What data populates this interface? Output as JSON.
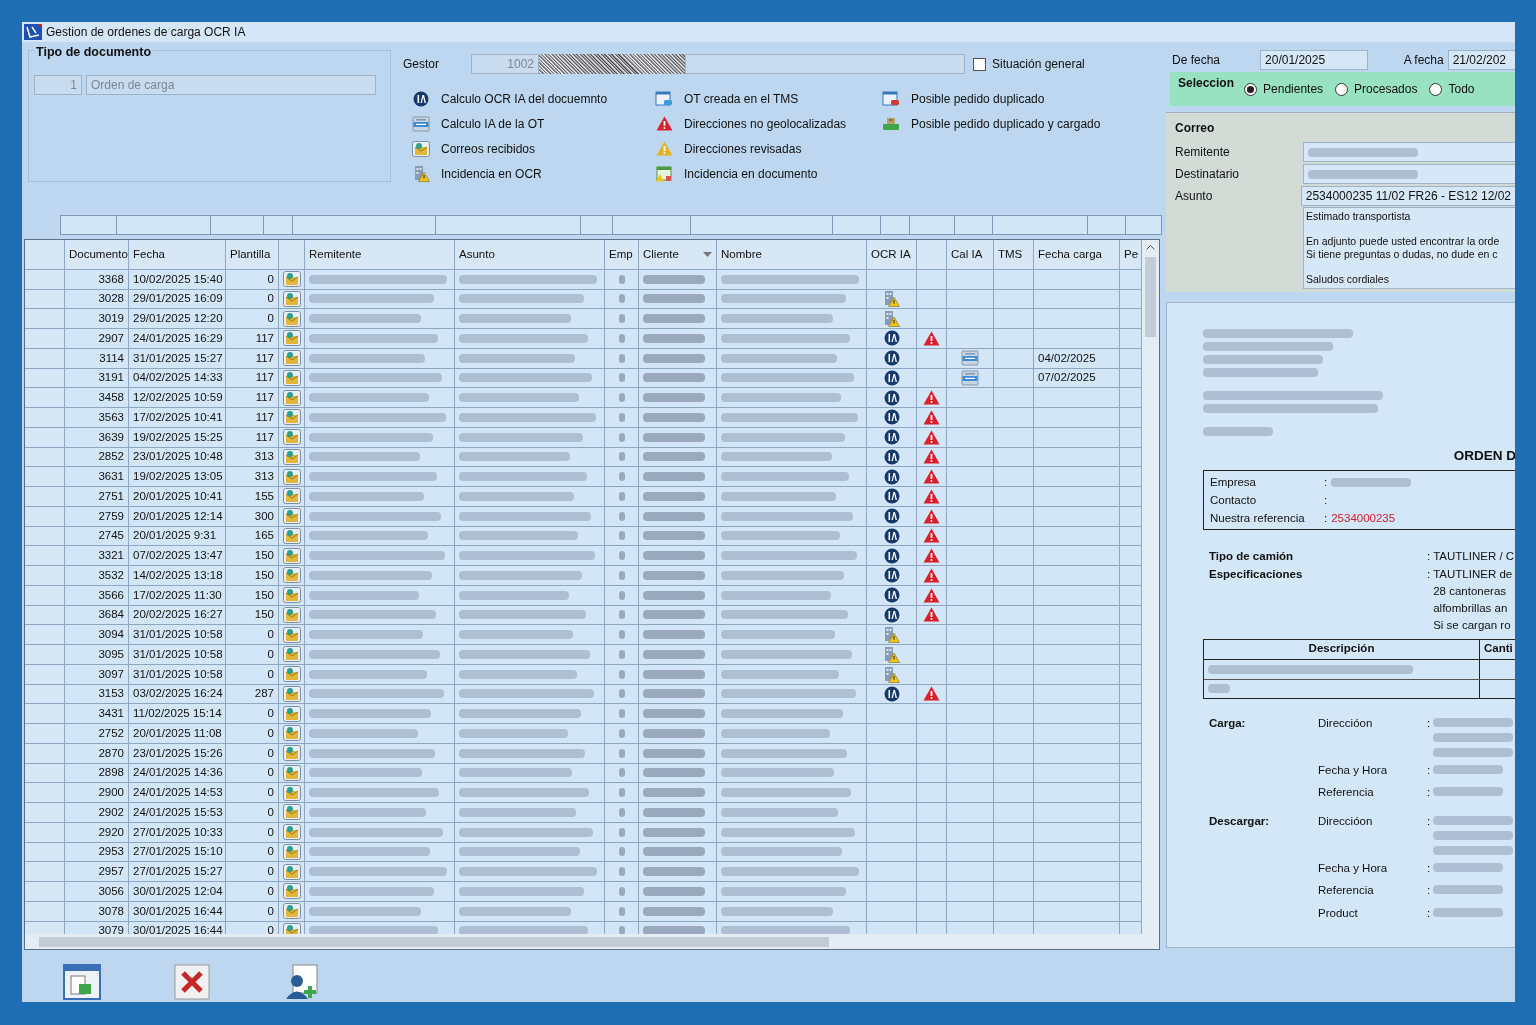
{
  "window": {
    "title": "Gestion de ordenes de carga OCR IA"
  },
  "document_type": {
    "title": "Tipo de documento",
    "code": "1",
    "name": "Orden de carga"
  },
  "gestor": {
    "label": "Gestor",
    "code": "1002"
  },
  "general_situation": {
    "label": "Situación general",
    "checked": false
  },
  "legend": [
    {
      "items": [
        {
          "kind": "ocr_ia",
          "label": "Calculo OCR IA del docuemnto"
        },
        {
          "kind": "cal_ia",
          "label": "Calculo IA de la OT"
        },
        {
          "kind": "mail",
          "label": "Correos recibidos"
        },
        {
          "kind": "ocr_incident",
          "label": "Incidencia en OCR"
        }
      ]
    },
    {
      "items": [
        {
          "kind": "tms",
          "label": "OT creada en el TMS"
        },
        {
          "kind": "red_alert",
          "label": "Direcciones no geolocalizadas"
        },
        {
          "kind": "yellow_alert",
          "label": "Direcciones revisadas"
        },
        {
          "kind": "doc_incident",
          "label": "Incidencia en documento"
        }
      ]
    },
    {
      "items": [
        {
          "kind": "duplicate",
          "label": "Posible pedido duplicado"
        },
        {
          "kind": "duplicate_loaded",
          "label": "Posible pedido duplicado y cargado"
        }
      ]
    }
  ],
  "date_range": {
    "from_label": "De fecha",
    "from": "20/01/2025",
    "to_label": "A fecha",
    "to": "21/02/202"
  },
  "selection": {
    "title": "Seleccion",
    "options": [
      {
        "label": "Pendientes",
        "selected": true
      },
      {
        "label": "Procesados",
        "selected": false
      },
      {
        "label": "Todo",
        "selected": false
      }
    ]
  },
  "mail": {
    "title": "Correo",
    "fields": [
      {
        "label": "Remitente",
        "kind": "blurred"
      },
      {
        "label": "Destinatario",
        "kind": "blurred"
      },
      {
        "label": "Asunto",
        "kind": "text",
        "value": "2534000235 11/02 FR26  - ES12 12/02"
      }
    ],
    "body": [
      "Estimado transportista",
      "En adjunto puede usted encontrar la orde\nSi tiene preguntas o dudas, no dude en c",
      "Saludos cordiales"
    ]
  },
  "table": {
    "columns": [
      "Documento",
      "Fecha",
      "Plantilla",
      "Remitente",
      "Asunto",
      "Emp",
      "Cliente",
      "Nombre",
      "OCR IA",
      "Cal IA",
      "TMS",
      "Fecha carga",
      "Pe"
    ],
    "rows": [
      {
        "documento": "3368",
        "fecha": "10/02/2025 15:40",
        "plantilla": "0",
        "kind": "none",
        "alert": false,
        "cal_ia": false
      },
      {
        "documento": "3028",
        "fecha": "29/01/2025 16:09",
        "plantilla": "0",
        "kind": "incident",
        "alert": false,
        "cal_ia": false
      },
      {
        "documento": "3019",
        "fecha": "29/01/2025 12:20",
        "plantilla": "0",
        "kind": "incident",
        "alert": false,
        "cal_ia": false
      },
      {
        "documento": "2907",
        "fecha": "24/01/2025 16:29",
        "plantilla": "117",
        "kind": "ia",
        "alert": true,
        "cal_ia": false
      },
      {
        "documento": "3114",
        "fecha": "31/01/2025 15:27",
        "plantilla": "117",
        "kind": "ia",
        "alert": false,
        "cal_ia": true,
        "fecha_carga": "04/02/2025"
      },
      {
        "documento": "3191",
        "fecha": "04/02/2025 14:33",
        "plantilla": "117",
        "kind": "ia",
        "alert": false,
        "cal_ia": true,
        "fecha_carga": "07/02/2025"
      },
      {
        "documento": "3458",
        "fecha": "12/02/2025 10:59",
        "plantilla": "117",
        "kind": "ia",
        "alert": true,
        "cal_ia": false
      },
      {
        "documento": "3563",
        "fecha": "17/02/2025 10:41",
        "plantilla": "117",
        "kind": "ia",
        "alert": true,
        "cal_ia": false
      },
      {
        "documento": "3639",
        "fecha": "19/02/2025 15:25",
        "plantilla": "117",
        "kind": "ia",
        "alert": true,
        "cal_ia": false
      },
      {
        "documento": "2852",
        "fecha": "23/01/2025 10:48",
        "plantilla": "313",
        "kind": "ia",
        "alert": true,
        "cal_ia": false
      },
      {
        "documento": "3631",
        "fecha": "19/02/2025 13:05",
        "plantilla": "313",
        "kind": "ia",
        "alert": true,
        "cal_ia": false
      },
      {
        "documento": "2751",
        "fecha": "20/01/2025 10:41",
        "plantilla": "155",
        "kind": "ia",
        "alert": true,
        "cal_ia": false
      },
      {
        "documento": "2759",
        "fecha": "20/01/2025 12:14",
        "plantilla": "300",
        "kind": "ia",
        "alert": true,
        "cal_ia": false
      },
      {
        "documento": "2745",
        "fecha": "20/01/2025 9:31",
        "plantilla": "165",
        "kind": "ia",
        "alert": true,
        "cal_ia": false
      },
      {
        "documento": "3321",
        "fecha": "07/02/2025 13:47",
        "plantilla": "150",
        "kind": "ia",
        "alert": true,
        "cal_ia": false
      },
      {
        "documento": "3532",
        "fecha": "14/02/2025 13:18",
        "plantilla": "150",
        "kind": "ia",
        "alert": true,
        "cal_ia": false
      },
      {
        "documento": "3566",
        "fecha": "17/02/2025 11:30",
        "plantilla": "150",
        "kind": "ia",
        "alert": true,
        "cal_ia": false
      },
      {
        "documento": "3684",
        "fecha": "20/02/2025 16:27",
        "plantilla": "150",
        "kind": "ia",
        "alert": true,
        "cal_ia": false
      },
      {
        "documento": "3094",
        "fecha": "31/01/2025 10:58",
        "plantilla": "0",
        "kind": "incident",
        "alert": false,
        "cal_ia": false
      },
      {
        "documento": "3095",
        "fecha": "31/01/2025 10:58",
        "plantilla": "0",
        "kind": "incident",
        "alert": false,
        "cal_ia": false
      },
      {
        "documento": "3097",
        "fecha": "31/01/2025 10:58",
        "plantilla": "0",
        "kind": "incident",
        "alert": false,
        "cal_ia": false
      },
      {
        "documento": "3153",
        "fecha": "03/02/2025 16:24",
        "plantilla": "287",
        "kind": "ia",
        "alert": true,
        "cal_ia": false
      },
      {
        "documento": "3431",
        "fecha": "11/02/2025 15:14",
        "plantilla": "0",
        "kind": "none",
        "alert": false,
        "cal_ia": false
      },
      {
        "documento": "2752",
        "fecha": "20/01/2025 11:08",
        "plantilla": "0",
        "kind": "none",
        "alert": false,
        "cal_ia": false
      },
      {
        "documento": "2870",
        "fecha": "23/01/2025 15:26",
        "plantilla": "0",
        "kind": "none",
        "alert": false,
        "cal_ia": false
      },
      {
        "documento": "2898",
        "fecha": "24/01/2025 14:36",
        "plantilla": "0",
        "kind": "none",
        "alert": false,
        "cal_ia": false
      },
      {
        "documento": "2900",
        "fecha": "24/01/2025 14:53",
        "plantilla": "0",
        "kind": "none",
        "alert": false,
        "cal_ia": false
      },
      {
        "documento": "2902",
        "fecha": "24/01/2025 15:53",
        "plantilla": "0",
        "kind": "none",
        "alert": false,
        "cal_ia": false
      },
      {
        "documento": "2920",
        "fecha": "27/01/2025 10:33",
        "plantilla": "0",
        "kind": "none",
        "alert": false,
        "cal_ia": false
      },
      {
        "documento": "2953",
        "fecha": "27/01/2025 15:10",
        "plantilla": "0",
        "kind": "none",
        "alert": false,
        "cal_ia": false
      },
      {
        "documento": "2957",
        "fecha": "27/01/2025 15:27",
        "plantilla": "0",
        "kind": "none",
        "alert": false,
        "cal_ia": false
      },
      {
        "documento": "3056",
        "fecha": "30/01/2025 12:04",
        "plantilla": "0",
        "kind": "none",
        "alert": false,
        "cal_ia": false
      },
      {
        "documento": "3078",
        "fecha": "30/01/2025 16:44",
        "plantilla": "0",
        "kind": "none",
        "alert": false,
        "cal_ia": false
      },
      {
        "documento": "3079",
        "fecha": "30/01/2025 16:44",
        "plantilla": "0",
        "kind": "none",
        "alert": false,
        "cal_ia": false
      }
    ]
  },
  "preview": {
    "heading": "ORDEN D",
    "info": [
      {
        "label": "Empresa",
        "sep": ":",
        "kind": "blurred"
      },
      {
        "label": "Contacto",
        "sep": ":",
        "kind": "empty"
      },
      {
        "label": "Nuestra referencia",
        "sep": ":",
        "kind": "text",
        "value": "2534000235"
      }
    ],
    "specs": [
      {
        "label": "Tipo de camión",
        "sep": ":",
        "lines": [
          "TAUTLINER / C"
        ]
      },
      {
        "label": "Especificaciones",
        "sep": ":",
        "lines": [
          "TAUTLINER de",
          "28 cantoneras",
          "alfombrillas an",
          "Si se cargan ro"
        ]
      }
    ],
    "table_headers": [
      "Descripción",
      "Canti"
    ],
    "sections": [
      {
        "label": "Carga:",
        "rows": [
          {
            "label": "Direccióon",
            "sep": ":",
            "kind": "address"
          },
          {
            "label": "Fecha y Hora",
            "sep": ":",
            "kind": "single"
          },
          {
            "label": "Referencia",
            "sep": ":",
            "kind": "single"
          }
        ]
      },
      {
        "label": "Descargar:",
        "rows": [
          {
            "label": "Direccióon",
            "sep": ":",
            "kind": "address"
          },
          {
            "label": "Fecha y Hora",
            "sep": ":",
            "kind": "single"
          },
          {
            "label": "Referencia",
            "sep": ":",
            "kind": "single"
          },
          {
            "label": "Product",
            "sep": ":",
            "kind": "single"
          }
        ]
      }
    ]
  },
  "toolbar": [
    {
      "kind": "document"
    },
    {
      "kind": "delete"
    },
    {
      "kind": "assign_user"
    }
  ]
}
